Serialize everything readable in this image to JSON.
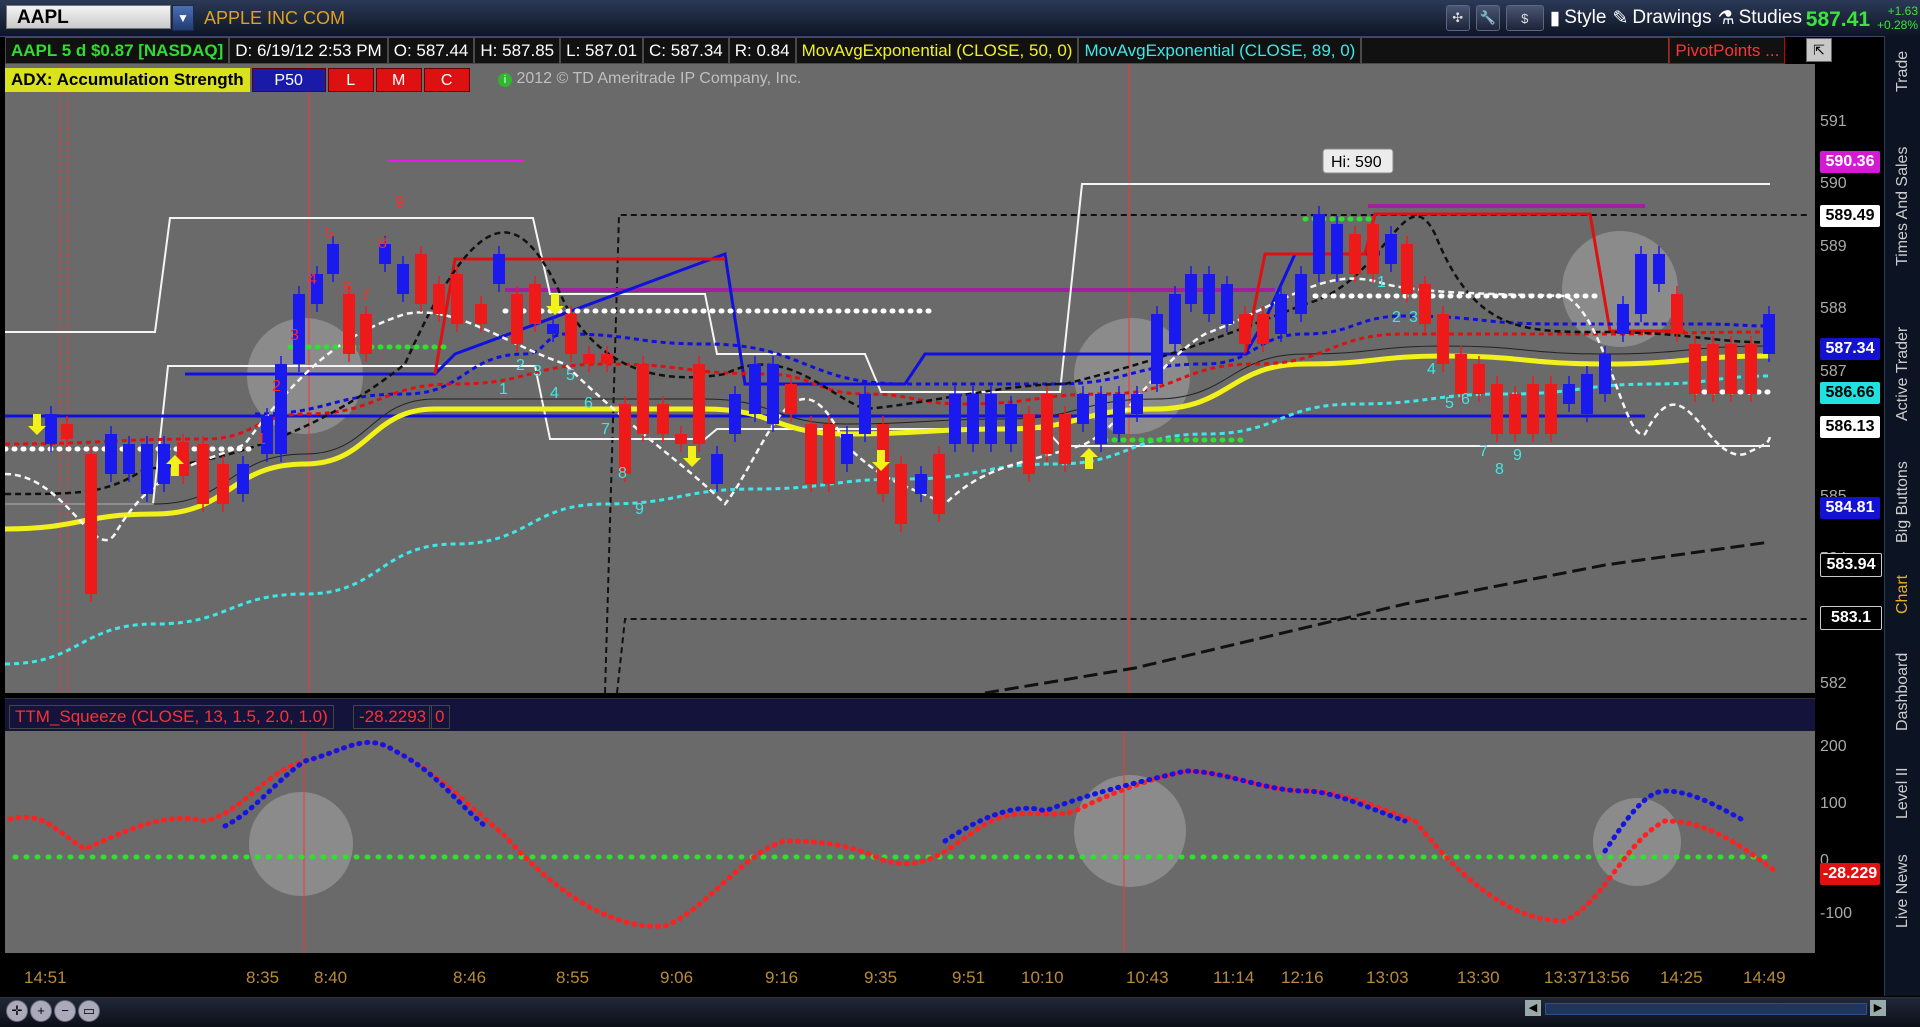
{
  "topbar": {
    "symbol": "AAPL",
    "company": "APPLE INC COM",
    "currency_icon": "$",
    "style_label": "Style",
    "drawings_label": "Drawings",
    "studies_label": "Studies",
    "last_price": "587.41",
    "change_abs": "+1.63",
    "change_pct": "+0.28%"
  },
  "infobar": {
    "ticker": "AAPL 5 d $0.87 [NASDAQ]",
    "date": "D: 6/19/12 2:53 PM",
    "open": "O: 587.44",
    "high": "H: 587.85",
    "low": "L: 587.01",
    "close": "C: 587.34",
    "range": "R: 0.84",
    "ema50": "MovAvgExponential (CLOSE, 50, 0)",
    "ema89": "MovAvgExponential (CLOSE, 89, 0)",
    "pivot": "PivotPoints ..."
  },
  "adx": {
    "label": "ADX:  Accumulation Strength",
    "pills": [
      "P50",
      "L",
      "M",
      "C"
    ],
    "copyright": "2012 © TD Ameritrade IP Company, Inc."
  },
  "annotations": {
    "hi_label": "Hi: 590",
    "counts_red": [
      "1",
      "2",
      "3",
      "4",
      "5",
      "6",
      "7",
      "8",
      "9"
    ],
    "counts_cyan": [
      "1",
      "2",
      "3",
      "4",
      "5",
      "6",
      "7",
      "8",
      "9"
    ]
  },
  "price_axis": {
    "ticks": [
      "591",
      "590",
      "589",
      "588",
      "587",
      "586",
      "585",
      "584",
      "583",
      "582"
    ],
    "tags": [
      {
        "value": "590.36",
        "bg": "#d21bd2",
        "fg": "#fff"
      },
      {
        "value": "589.49",
        "bg": "#fff",
        "fg": "#000"
      },
      {
        "value": "587.34",
        "bg": "#1212d0",
        "fg": "#fff"
      },
      {
        "value": "586.66",
        "bg": "#20e0e0",
        "fg": "#000"
      },
      {
        "value": "586.13",
        "bg": "#fff",
        "fg": "#000"
      },
      {
        "value": "584.81",
        "bg": "#1212d0",
        "fg": "#fff"
      },
      {
        "value": "583.94",
        "bg": "#000",
        "fg": "#fff"
      },
      {
        "value": "583.1",
        "bg": "#000",
        "fg": "#fff"
      }
    ]
  },
  "squeeze": {
    "title": "TTM_Squeeze (CLOSE, 13, 1.5, 2.0, 1.0)",
    "value": "-28.2293",
    "zero": "0",
    "ticks": [
      "200",
      "100",
      "0",
      "-100"
    ],
    "tag": "-28.229"
  },
  "time_axis": [
    "14:51",
    "8:35",
    "8:40",
    "8:46",
    "8:55",
    "9:06",
    "9:16",
    "9:35",
    "9:51",
    "10:10",
    "10:43",
    "11:14",
    "12:16",
    "13:03",
    "13:30",
    "13:37",
    "13:56",
    "14:25",
    "14:49"
  ],
  "sidebar_tabs": [
    "Trade",
    "Times And Sales",
    "Active Trader",
    "Big Buttons",
    "Chart",
    "Dashboard",
    "Level II",
    "Live News"
  ],
  "colors": {
    "bull_bar": "#1a1aee",
    "bear_bar": "#ee1a1a",
    "ema50": "#f2f21a",
    "ema89": "#3ee8e8",
    "squeeze_on": "#22e022",
    "squeeze_off": "#ee2020"
  }
}
